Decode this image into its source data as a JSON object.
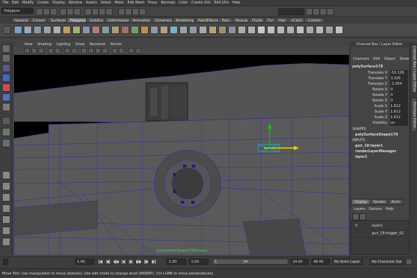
{
  "menubar": {
    "items": [
      "File",
      "Edit",
      "Modify",
      "Create",
      "Display",
      "Window",
      "Assets",
      "Select",
      "Mesh",
      "Edit Mesh",
      "Proxy",
      "Normals",
      "Color",
      "Create UVs",
      "Edit UVs",
      "Help"
    ]
  },
  "statusline": {
    "mode": "Polygons"
  },
  "shelf": {
    "tabs": [
      "General",
      "Curves",
      "Surfaces",
      "Polygons",
      "Subdivs",
      "Deformation",
      "Animation",
      "Dynamics",
      "Rendering",
      "PaintEffects",
      "Toon",
      "Muscle",
      "Fluids",
      "Fur",
      "Hair",
      "nCloth",
      "Custom"
    ],
    "active_tab": "Polygons"
  },
  "viewport": {
    "menu": [
      "View",
      "Shading",
      "Lighting",
      "Show",
      "Renderer",
      "Panels"
    ],
    "hud_label": "polySurfaceShape178(shape)"
  },
  "channel_box": {
    "title": "Channel Box / Layer Editor",
    "menu": [
      "Channels",
      "Edit",
      "Object",
      "Show"
    ],
    "object": "polySurface178",
    "attributes": [
      {
        "label": "Translate X",
        "value": "-52.128"
      },
      {
        "label": "Translate Y",
        "value": "3.325"
      },
      {
        "label": "Translate Z",
        "value": "-1.054"
      },
      {
        "label": "Rotate X",
        "value": "0"
      },
      {
        "label": "Rotate Y",
        "value": "0"
      },
      {
        "label": "Rotate Z",
        "value": "0"
      },
      {
        "label": "Scale X",
        "value": "1.612"
      },
      {
        "label": "Scale Y",
        "value": "1.612"
      },
      {
        "label": "Scale Z",
        "value": "1.612"
      },
      {
        "label": "Visibility",
        "value": "on"
      }
    ],
    "shapes_header": "SHAPES",
    "shape": "polySurfaceShape178",
    "inputs_header": "INPUTS",
    "inputs": [
      "gun_18:layer1",
      "renderLayerManager",
      "layer1"
    ]
  },
  "side_tabs": [
    "Channel Box / Layer Editor",
    "Attribute Editor"
  ],
  "layer_editor": {
    "tabs": [
      "Display",
      "Render",
      "Anim"
    ],
    "active_tab": "Display",
    "menu": [
      "Layers",
      "Options",
      "Help"
    ],
    "layers": [
      {
        "visible": "V",
        "name": "layer1"
      },
      {
        "visible": "",
        "name": "gun_18:trigger_01"
      }
    ]
  },
  "timeline": {
    "start": "1.00",
    "current": "1.00",
    "range_start_label": "1",
    "range_end_label": "24",
    "end": "24.00",
    "anim_end": "48.00",
    "anim_layer": "No Anim Layer",
    "char_set": "No Character Set",
    "playback_buttons": [
      "|◀",
      "◀|",
      "◀◀",
      "◀",
      "▶",
      "▶▶",
      "|▶",
      "▶|"
    ]
  },
  "helpline": {
    "text": "Move Tool: Use manipulator to move object(s). Use edit mode to change pivot (INSERT). Ctrl+LMB to move perpendicular."
  },
  "colors": {
    "accent_active_tab": "#6a6a6a",
    "manipulator_x": "#e8e000",
    "manipulator_y": "#00d000",
    "wireframe": "#2222aa"
  }
}
